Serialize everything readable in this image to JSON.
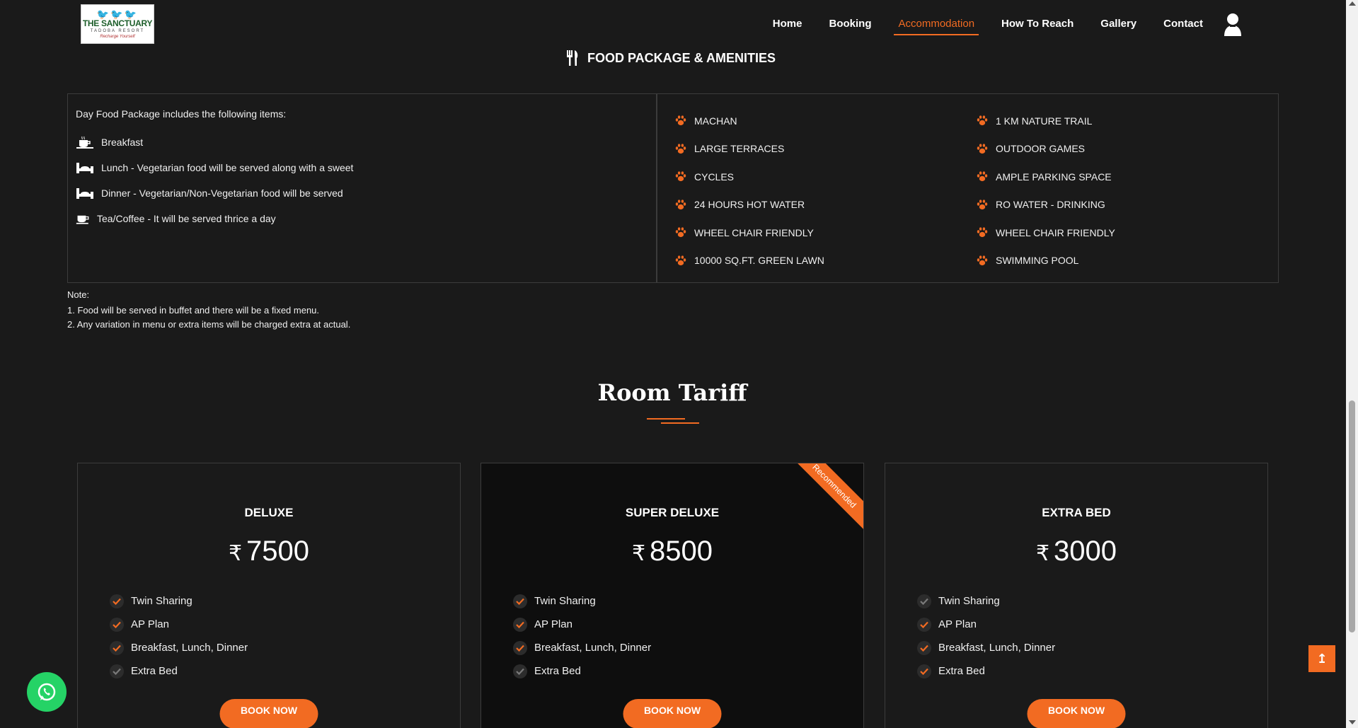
{
  "logo": {
    "line1": "THE SANCTUARY",
    "line2": "TADOBA RESORT",
    "line3": "Recharge Yourself"
  },
  "nav": {
    "items": [
      "Home",
      "Booking",
      "Accommodation",
      "How To Reach",
      "Gallery",
      "Contact"
    ],
    "active": "Accommodation"
  },
  "food": {
    "title": "FOOD PACKAGE & AMENITIES",
    "intro": "Day Food Package includes the following items:",
    "items": [
      "Breakfast",
      "Lunch - Vegetarian food will be served along with a sweet",
      "Dinner - Vegetarian/Non-Vegetarian food will be served",
      "Tea/Coffee - It will be served thrice a day"
    ]
  },
  "amenities": {
    "col1": [
      "MACHAN",
      "LARGE TERRACES",
      "CYCLES",
      "24 HOURS HOT WATER",
      "WHEEL CHAIR FRIENDLY",
      "10000 SQ.FT. GREEN LAWN"
    ],
    "col2": [
      "1 KM NATURE TRAIL",
      "OUTDOOR GAMES",
      "AMPLE PARKING SPACE",
      "RO WATER - DRINKING",
      "WHEEL CHAIR FRIENDLY",
      "SWIMMING POOL"
    ]
  },
  "note": {
    "heading": "Note:",
    "lines": [
      "1. Food will be served in buffet and there will be a fixed menu.",
      "2. Any variation in menu or extra items will be charged extra at actual."
    ]
  },
  "tariff": {
    "title": "Room Tariff",
    "currency": "₹",
    "book_label": "BOOK NOW",
    "ribbon": "Recommended",
    "cards": [
      {
        "name": "DELUXE",
        "price": "7500",
        "features": [
          "Twin Sharing",
          "AP Plan",
          "Breakfast, Lunch, Dinner",
          "Extra Bed"
        ],
        "included": [
          true,
          true,
          true,
          false
        ]
      },
      {
        "name": "SUPER DELUXE",
        "price": "8500",
        "features": [
          "Twin Sharing",
          "AP Plan",
          "Breakfast, Lunch, Dinner",
          "Extra Bed"
        ],
        "included": [
          true,
          true,
          true,
          false
        ]
      },
      {
        "name": "EXTRA BED",
        "price": "3000",
        "features": [
          "Twin Sharing",
          "AP Plan",
          "Breakfast, Lunch, Dinner",
          "Extra Bed"
        ],
        "included": [
          false,
          true,
          true,
          true
        ]
      }
    ]
  },
  "colors": {
    "accent": "#f26b22",
    "background": "#1a1a1a",
    "whatsapp": "#25d366"
  }
}
